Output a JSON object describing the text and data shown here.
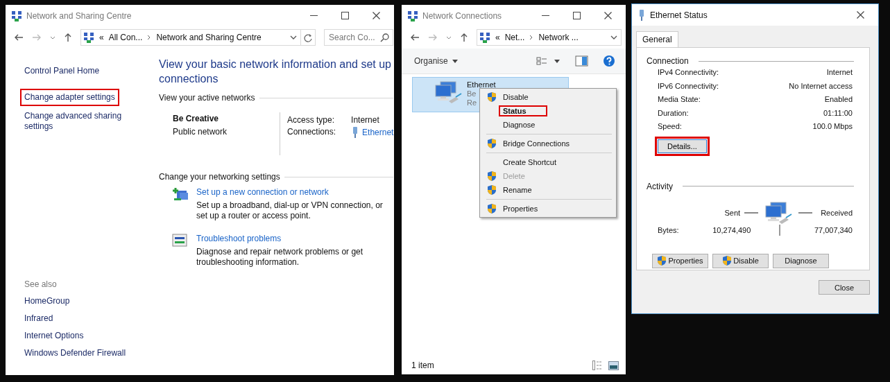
{
  "sharing_centre": {
    "title": "Network and Sharing Centre",
    "address": {
      "overflow": "«",
      "segments": [
        "All Con...",
        "Network and Sharing Centre"
      ]
    },
    "search": {
      "placeholder": "Search Co..."
    },
    "sidebar": {
      "links": [
        {
          "label": "Control Panel Home",
          "highlighted": false
        },
        {
          "label": "Change adapter settings",
          "highlighted": true
        },
        {
          "label": "Change advanced sharing settings",
          "highlighted": false
        }
      ],
      "see_also": {
        "heading": "See also",
        "links": [
          "HomeGroup",
          "Infrared",
          "Internet Options",
          "Windows Defender Firewall"
        ]
      }
    },
    "main": {
      "heading": "View your basic network information and set up connections",
      "active_label": "View your active networks",
      "network": {
        "name": "Be Creative",
        "type": "Public network",
        "access_label": "Access type:",
        "access": "Internet",
        "connections_label": "Connections:",
        "connection": "Ethernet"
      },
      "settings_label": "Change your networking settings",
      "tasks": [
        {
          "kind": "setup",
          "title": "Set up a new connection or network",
          "description": "Set up a broadband, dial-up or VPN connection, or set up a router or access point."
        },
        {
          "kind": "troubleshoot",
          "title": "Troubleshoot problems",
          "description": "Diagnose and repair network problems or get troubleshooting information."
        }
      ]
    }
  },
  "network_connections": {
    "title": "Network Connections",
    "address": {
      "overflow": "«",
      "segments": [
        "Net...",
        "Network ..."
      ]
    },
    "organise": "Organise",
    "item": {
      "name": "Ethernet",
      "line_1": "Be",
      "line_2": "Re",
      "selected": true
    },
    "context_menu": [
      {
        "label": "Disable",
        "shield": true,
        "bold": false,
        "disabled": false,
        "highlighted": false,
        "separator_before": false
      },
      {
        "label": "Status",
        "shield": false,
        "bold": true,
        "disabled": false,
        "highlighted": true,
        "separator_before": false
      },
      {
        "label": "Diagnose",
        "shield": false,
        "bold": false,
        "disabled": false,
        "highlighted": false,
        "separator_before": false
      },
      {
        "label": "Bridge Connections",
        "shield": true,
        "bold": false,
        "disabled": false,
        "highlighted": false,
        "separator_before": true
      },
      {
        "label": "Create Shortcut",
        "shield": false,
        "bold": false,
        "disabled": false,
        "highlighted": false,
        "separator_before": true
      },
      {
        "label": "Delete",
        "shield": true,
        "bold": false,
        "disabled": true,
        "highlighted": false,
        "separator_before": false
      },
      {
        "label": "Rename",
        "shield": true,
        "bold": false,
        "disabled": false,
        "highlighted": false,
        "separator_before": false
      },
      {
        "label": "Properties",
        "shield": true,
        "bold": false,
        "disabled": false,
        "highlighted": false,
        "separator_before": true
      }
    ],
    "status": "1 item"
  },
  "ethernet_status": {
    "title": "Ethernet Status",
    "tabs": [
      {
        "label": "General",
        "selected": true
      }
    ],
    "connection_label": "Connection",
    "rows": [
      {
        "label": "IPv4 Connectivity:",
        "value": "Internet"
      },
      {
        "label": "IPv6 Connectivity:",
        "value": "No Internet access"
      },
      {
        "label": "Media State:",
        "value": "Enabled"
      },
      {
        "label": "Duration:",
        "value": "01:11:00"
      },
      {
        "label": "Speed:",
        "value": "100.0 Mbps"
      }
    ],
    "details_button": {
      "label": "Details...",
      "highlighted": true
    },
    "activity_label": "Activity",
    "sent": "Sent",
    "received": "Received",
    "bytes_label": "Bytes:",
    "bytes_sent": "10,274,490",
    "bytes_received": "77,007,340",
    "buttons": [
      {
        "label": "Properties",
        "shield": true
      },
      {
        "label": "Disable",
        "shield": true
      },
      {
        "label": "Diagnose",
        "shield": false
      }
    ],
    "close": "Close"
  }
}
